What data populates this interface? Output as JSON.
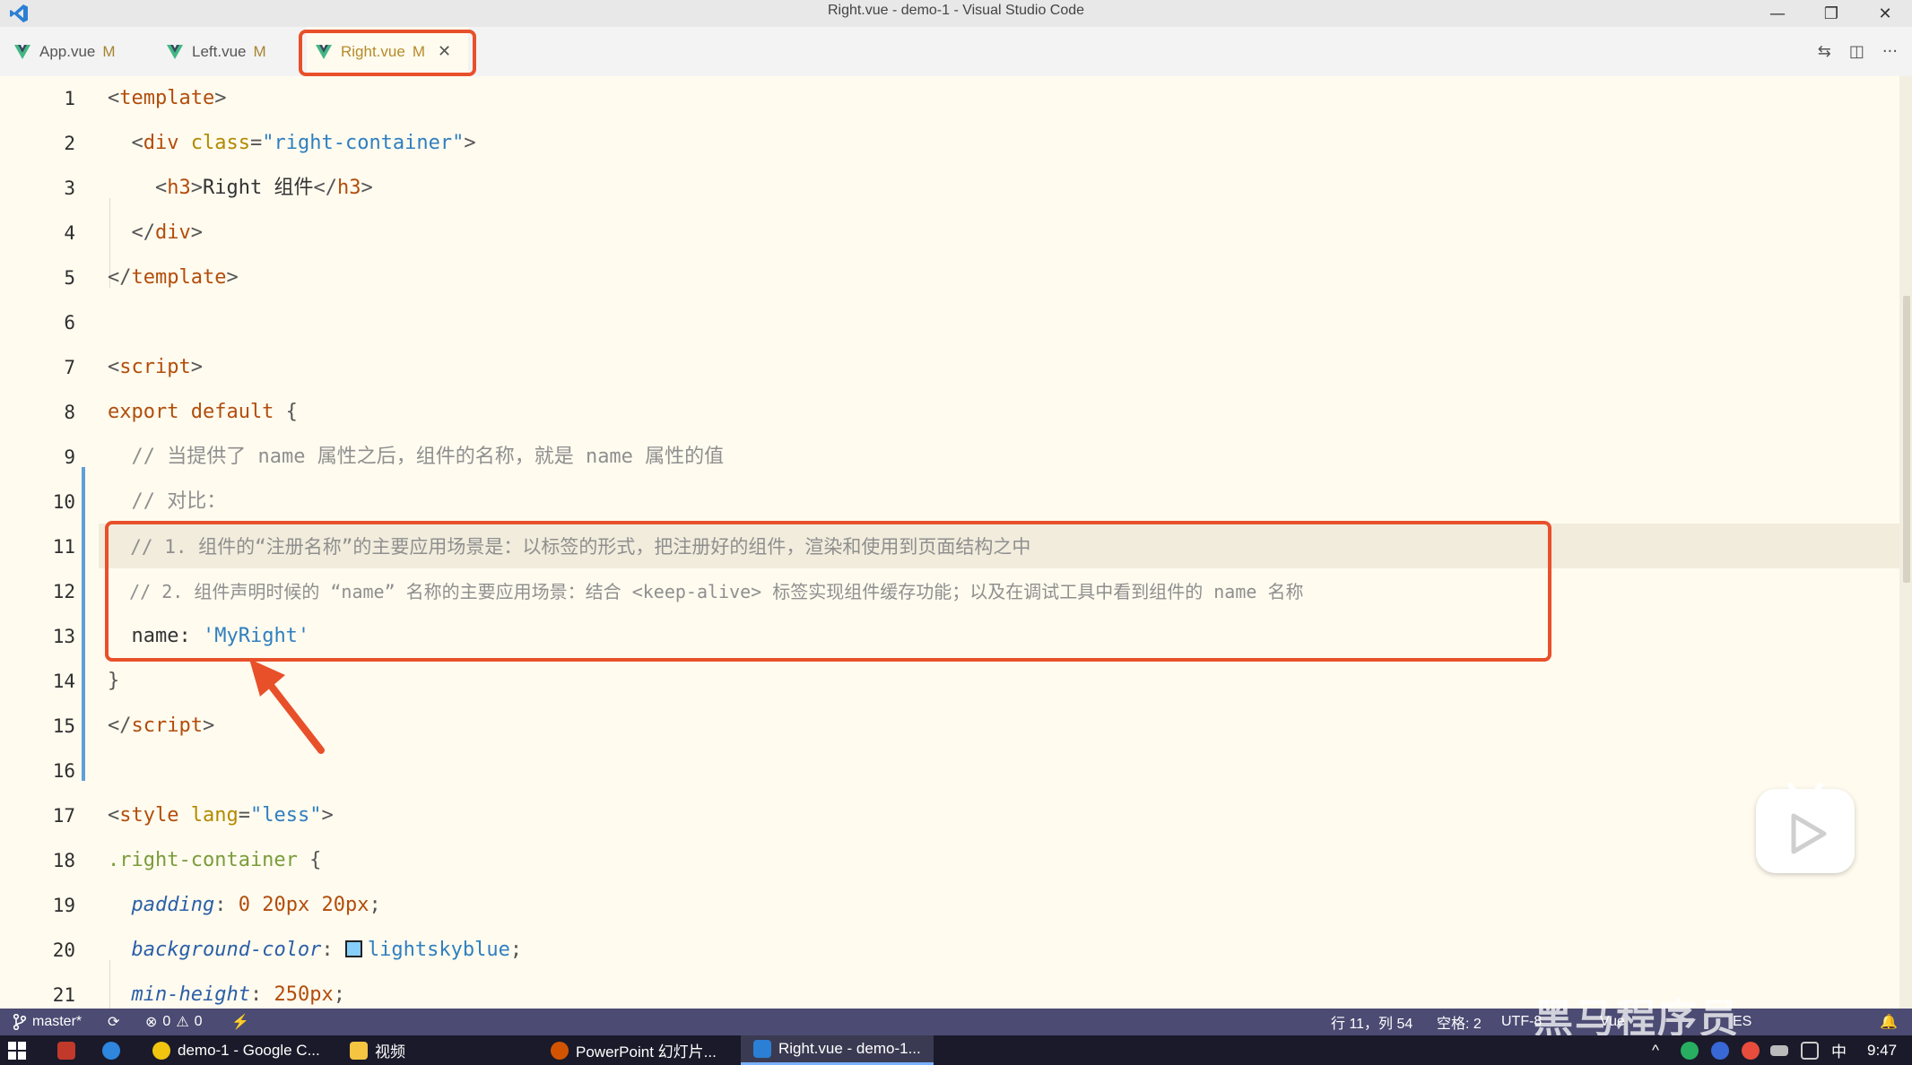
{
  "window": {
    "title": "Right.vue - demo-1 - Visual Studio Code",
    "minimize_glyph": "—",
    "restore_glyph": "❐",
    "close_glyph": "✕"
  },
  "tabs": [
    {
      "label": "App.vue",
      "status": "M"
    },
    {
      "label": "Left.vue",
      "status": "M"
    },
    {
      "label": "Right.vue",
      "status": "M",
      "active": true,
      "close_glyph": "✕"
    }
  ],
  "tab_tools": {
    "compare_glyph": "⇆",
    "split_glyph": "◫",
    "more_glyph": "···"
  },
  "editor": {
    "lines": [
      {
        "n": "1"
      },
      {
        "n": "2"
      },
      {
        "n": "3"
      },
      {
        "n": "4"
      },
      {
        "n": "5"
      },
      {
        "n": "6"
      },
      {
        "n": "7"
      },
      {
        "n": "8"
      },
      {
        "n": "9"
      },
      {
        "n": "10"
      },
      {
        "n": "11"
      },
      {
        "n": "12"
      },
      {
        "n": "13"
      },
      {
        "n": "14"
      },
      {
        "n": "15"
      },
      {
        "n": "16"
      },
      {
        "n": "17"
      },
      {
        "n": "18"
      },
      {
        "n": "19"
      },
      {
        "n": "20"
      },
      {
        "n": "21"
      }
    ],
    "code": {
      "l1_open": "<",
      "l1_tag": "template",
      "l1_close": ">",
      "l2_indent": "  ",
      "l2_open": "<",
      "l2_tag": "div",
      "l2_attr": " class",
      "l2_eq": "=",
      "l2_val": "\"right-container\"",
      "l2_close": ">",
      "l3_indent": "    ",
      "l3_open": "<",
      "l3_tag": "h3",
      "l3_close": ">",
      "l3_text": "Right 组件",
      "l3_end_open": "</",
      "l3_end_tag": "h3",
      "l3_end_close": ">",
      "l4_indent": "  ",
      "l4_open": "</",
      "l4_tag": "div",
      "l4_close": ">",
      "l5_open": "</",
      "l5_tag": "template",
      "l5_close": ">",
      "l7_open": "<",
      "l7_tag": "script",
      "l7_close": ">",
      "l8_kw": "export default",
      "l8_brace": " {",
      "l9_comment": "  // 当提供了 name 属性之后，组件的名称，就是 name 属性的值",
      "l10_comment": "  // 对比：",
      "l11_comment": "  // 1. 组件的“注册名称”的主要应用场景是：以标签的形式，把注册好的组件，渲染和使用到页面结构之中",
      "l12_comment": "  // 2. 组件声明时候的 “name” 名称的主要应用场景：结合 <keep-alive> 标签实现组件缓存功能；以及在调试工具中看到组件的 name 名称",
      "l13_key": "  name: ",
      "l13_val": "'MyRight'",
      "l14_brace": "}",
      "l15_open": "</",
      "l15_tag": "script",
      "l15_close": ">",
      "l17_open": "<",
      "l17_tag": "style",
      "l17_attr": " lang",
      "l17_eq": "=",
      "l17_val": "\"less\"",
      "l17_close": ">",
      "l18_sel": ".right-container",
      "l18_brace": " {",
      "l19_indent": "  ",
      "l19_prop": "padding",
      "l19_colon": ": ",
      "l19_v1": "0",
      "l19_sp1": " ",
      "l19_v2": "20",
      "l19_u2": "px",
      "l19_sp2": " ",
      "l19_v3": "20",
      "l19_u3": "px",
      "l19_semi": ";",
      "l20_indent": "  ",
      "l20_prop": "background-color",
      "l20_colon": ": ",
      "l20_val": "lightskyblue",
      "l20_semi": ";",
      "l21_indent": "  ",
      "l21_prop": "min-height",
      "l21_colon": ": ",
      "l21_v": "250",
      "l21_u": "px",
      "l21_semi": ";"
    }
  },
  "statusbar": {
    "branch": "master*",
    "sync_glyph": "⟳",
    "errors": "0",
    "warnings": "0",
    "position": "行 11，列 54",
    "spaces": "空格: 2",
    "encoding": "UTF-8",
    "extra": "Vue",
    "eslint": "ES"
  },
  "taskbar": {
    "items": [
      {
        "label": "demo-1 - Google C..."
      },
      {
        "label": "视频"
      },
      {
        "label": "PowerPoint 幻灯片..."
      },
      {
        "label": "Right.vue - demo-1..."
      }
    ],
    "ime": "中",
    "clock": "9:47",
    "tray_up": "^"
  },
  "watermark": "黑马程序员",
  "colors": {
    "accent": "#e8502a",
    "statusbar": "#4b4b73",
    "editor_bg": "#fffbef",
    "vue_green": "#41b883"
  }
}
